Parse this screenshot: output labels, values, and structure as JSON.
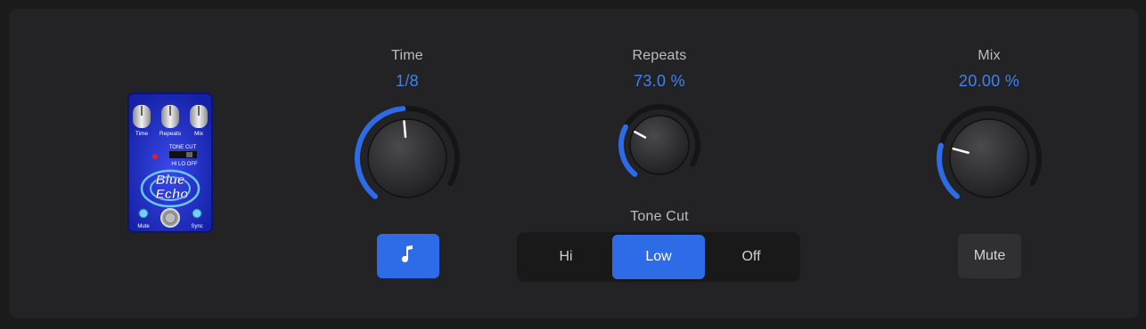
{
  "plugin": {
    "pedal_image": {
      "brand_text": "Blue Echo",
      "knob_labels": [
        "Time",
        "Repeats",
        "Mix"
      ],
      "tone_cut_label": "TONE CUT",
      "tone_cut_positions": "HI LO OFF",
      "footswitch_labels": [
        "Mute",
        "Sync"
      ]
    },
    "time": {
      "label": "Time",
      "value": "1/8",
      "arc_fraction": 0.52
    },
    "repeats": {
      "label": "Repeats",
      "value": "73.0 %",
      "arc_fraction": 0.3
    },
    "mix": {
      "label": "Mix",
      "value": "20.00 %",
      "arc_fraction": 0.25
    },
    "sync_button": {
      "icon": "music-note-icon",
      "active": true
    },
    "tone_cut": {
      "label": "Tone Cut",
      "options": [
        "Hi",
        "Low",
        "Off"
      ],
      "selected": "Low"
    },
    "mute_button": {
      "label": "Mute",
      "active": false
    }
  },
  "colors": {
    "accent": "#2e6be6",
    "value_text": "#3d82f5",
    "background": "#232325"
  }
}
